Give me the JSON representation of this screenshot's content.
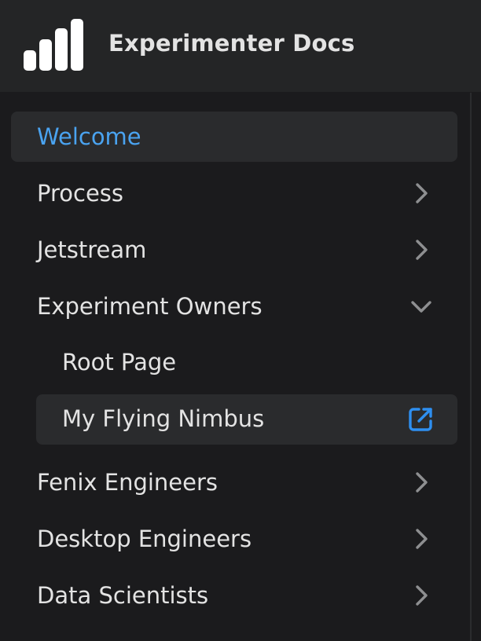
{
  "header": {
    "title": "Experimenter Docs",
    "logo_icon": "bar-chart-logo-icon",
    "logo_color": "#ffffff"
  },
  "sidebar": {
    "active_color": "#4aa3f0",
    "items": [
      {
        "label": "Welcome",
        "active": true
      },
      {
        "label": "Process",
        "caret": "chevron-right-icon"
      },
      {
        "label": "Jetstream",
        "caret": "chevron-right-icon"
      },
      {
        "label": "Experiment Owners",
        "caret": "chevron-down-icon",
        "expanded": true,
        "children": [
          {
            "label": "Root Page"
          },
          {
            "label": "My Flying Nimbus",
            "external": true,
            "icon": "external-link-icon"
          }
        ]
      },
      {
        "label": "Fenix Engineers",
        "caret": "chevron-right-icon"
      },
      {
        "label": "Desktop Engineers",
        "caret": "chevron-right-icon"
      },
      {
        "label": "Data Scientists",
        "caret": "chevron-right-icon"
      }
    ]
  }
}
